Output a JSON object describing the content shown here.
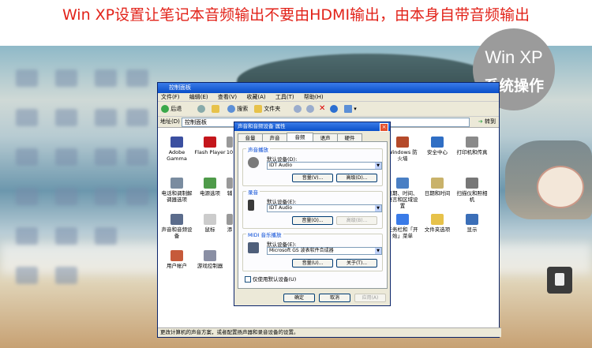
{
  "banner": {
    "title": "Win XP设置让笔记本音频输出不要由HDMI输出，由本身自带音频输出"
  },
  "badge": {
    "line1": "Win XP",
    "line2": "系统操作"
  },
  "control_panel": {
    "title": "控制面板",
    "menu": [
      "文件(F)",
      "编辑(E)",
      "查看(V)",
      "收藏(A)",
      "工具(T)",
      "帮助(H)"
    ],
    "toolbar": {
      "back": "后退",
      "search": "搜索",
      "folders": "文件夹"
    },
    "address_label": "地址(D)",
    "address_value": "控制面板",
    "go_label": "转到",
    "items": [
      "Adobe Gamma",
      "Flash Player",
      "10",
      "Windows 防火墙",
      "安全中心",
      "打印机和传真",
      "电话和调制解调器选项",
      "电源选项",
      "辅",
      "日期、时间、语言和区域设置",
      "日期和时间",
      "扫描仪和照相机",
      "声音和音频设备",
      "鼠标",
      "添",
      "任务栏和「开始」菜单",
      "文件夹选项",
      "显示",
      "用户帐户",
      "游戏控制器"
    ],
    "status": "更改计算机的声音方案，或者配置扬声器和录音设备的设置。"
  },
  "dialog": {
    "title": "声音和音频设备 属性",
    "close": "×",
    "tabs": [
      "音量",
      "声音",
      "音频",
      "语声",
      "硬件"
    ],
    "active_tab": "音频",
    "playback": {
      "group": "声音播放",
      "default_label": "默认设备(D):",
      "device": "IDT Audio",
      "volume_btn": "音量(V)...",
      "advanced_btn": "高级(D)..."
    },
    "recording": {
      "group": "录音",
      "default_label": "默认设备(E):",
      "device": "IDT Audio",
      "volume_btn": "音量(O)...",
      "advanced_btn": "高级(B)..."
    },
    "midi": {
      "group": "MIDI 音乐播放",
      "default_label": "默认设备(E):",
      "device": "Microsoft GS 波表软件合成器",
      "volume_btn": "音量(U)...",
      "about_btn": "关于(T)..."
    },
    "checkbox": "仅使用默认设备(U)",
    "ok": "确定",
    "cancel": "取消",
    "apply": "应用(A)"
  }
}
